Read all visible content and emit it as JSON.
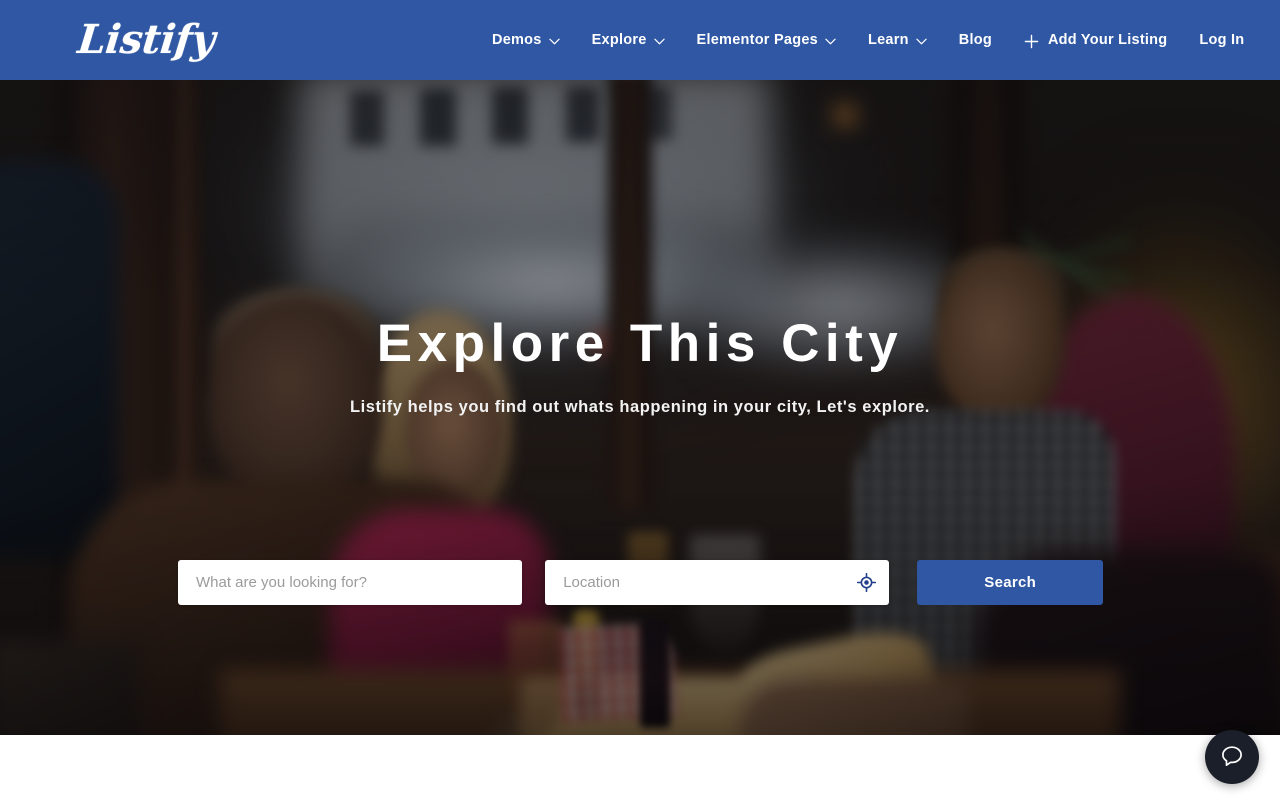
{
  "header": {
    "logo_text": "Listify",
    "background_color": "#2f57a3",
    "nav": [
      {
        "label": "Demos",
        "icon": "chevron-down-icon",
        "has_dropdown": true
      },
      {
        "label": "Explore",
        "icon": "chevron-down-icon",
        "has_dropdown": true
      },
      {
        "label": "Elementor Pages",
        "icon": "chevron-down-icon",
        "has_dropdown": true
      },
      {
        "label": "Learn",
        "icon": "chevron-down-icon",
        "has_dropdown": true
      },
      {
        "label": "Blog",
        "has_dropdown": false
      },
      {
        "label": "Add Your Listing",
        "icon": "plus-icon",
        "has_dropdown": false
      },
      {
        "label": "Log In",
        "has_dropdown": false
      }
    ]
  },
  "hero": {
    "title": "Explore This City",
    "subtitle": "Listify helps you find out whats happening in your city, Let's explore.",
    "image_description": "Friends eating pizza at a restaurant table by a window"
  },
  "search": {
    "keyword_placeholder": "What are you looking for?",
    "keyword_value": "",
    "location_placeholder": "Location",
    "location_value": "",
    "geolocate_icon": "crosshair-target-icon",
    "button_label": "Search",
    "button_color": "#2f57a3"
  },
  "chat": {
    "icon": "chat-bubble-icon",
    "background_color": "#1b1f2a"
  }
}
